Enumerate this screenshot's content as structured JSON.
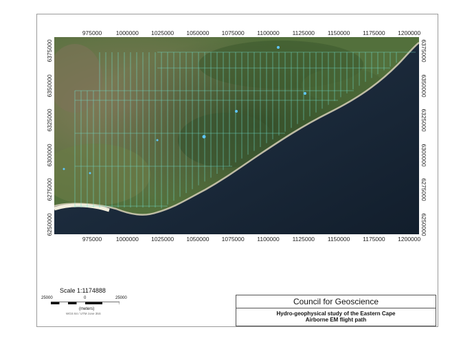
{
  "map": {
    "x_ticks": [
      "975000",
      "1000000",
      "1025000",
      "1050000",
      "1075000",
      "1100000",
      "1125000",
      "1150000",
      "1175000",
      "1200000"
    ],
    "y_ticks": [
      "6375000",
      "6350000",
      "6325000",
      "6300000",
      "6275000",
      "6250000"
    ],
    "colors": {
      "land_green": "#4a6b38",
      "land_brown": "#7b6e52",
      "ocean": "#1b2c3d",
      "beach": "#e9e3cf",
      "flight_line": "#6fe0cf"
    }
  },
  "scale": {
    "title": "Scale 1:1174888",
    "left_label": "25000",
    "center_label": "0",
    "right_label": "25000",
    "unit": "(meters)",
    "projection": "WGS 84 / UTM zone 35S"
  },
  "title_block": {
    "organization": "Council for Geoscience",
    "line1": "Hydro-geophysical study of the Eastern Cape",
    "line2": "Airborne EM flight path"
  }
}
